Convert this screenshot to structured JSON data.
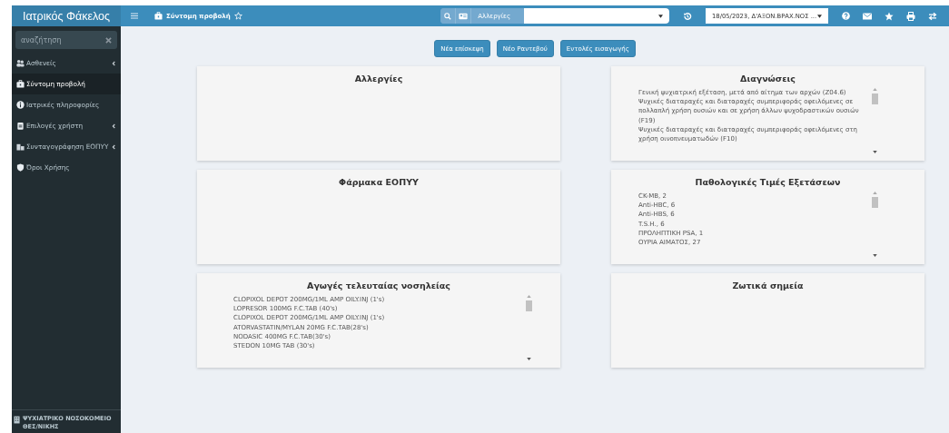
{
  "app_title": "Ιατρικός Φάκελος",
  "sidebar": {
    "search": {
      "placeholder": "αναζήτηση"
    },
    "items": [
      {
        "label": "Ασθενείς",
        "expandable": true,
        "selected": false
      },
      {
        "label": "Σύντομη προβολή",
        "expandable": false,
        "selected": true
      },
      {
        "label": "Ιατρικές πληροφορίες",
        "expandable": false,
        "selected": false
      },
      {
        "label": "Επιλογές χρήστη",
        "expandable": true,
        "selected": false
      },
      {
        "label": "Συνταγογράφηση ΕΟΠΥΥ",
        "expandable": true,
        "selected": false
      },
      {
        "label": "Όροι Χρήσης",
        "expandable": false,
        "selected": false
      }
    ],
    "footer": "ΨΥΧΙΑΤΡΙΚΟ ΝΟΣΟΚΟΜΕΙΟ ΘΕΣ/ΝΙΚΗΣ"
  },
  "topbar": {
    "breadcrumb": "Σύντομη προβολή",
    "search_label": "Αλλεργίες",
    "visit": "18/05/2023, Δ'ΑΞΟΝ.ΒΡΑΧ.ΝΟΣ ..."
  },
  "buttons": [
    "Νέα επίσκεψη",
    "Νέο Ραντεβού",
    "Εντολές εισαγωγής"
  ],
  "cards": [
    {
      "title": "Αλλεργίες"
    },
    {
      "title": "Διαγνώσεις",
      "items": [
        "Γενική ψυχιατρική εξέταση, μετά από αίτημα των αρχών (Z04.6)",
        "Ψυχικές διαταραχές και διαταραχές συμπεριφοράς οφειλόμενες σε πολλαπλή χρήση ουσιών και σε χρήση άλλων ψυχοδραστικών ουσιών (F19)",
        "Ψυχικές διαταραχές και διαταραχές συμπεριφοράς οφειλόμενες στη χρήση οινοπνευματωδών (F10)"
      ]
    },
    {
      "title": "Φάρμακα ΕΟΠΥΥ"
    },
    {
      "title": "Παθολογικές Τιμές Εξετάσεων",
      "items": [
        "CK-MB, 2",
        "Anti-HBC, 6",
        "Anti-HBS, 6",
        "T.S.H., 6",
        "ΠΡΟΛΗΠΤΙΚΗ PSA, 1",
        "ΟΥΡΙΑ ΑΙΜΑΤΟΣ, 27"
      ]
    },
    {
      "title": "Αγωγές τελευταίας νοσηλείας",
      "items": [
        "CLOPIXOL DEPOT 200MG/1ML AMP OILY.INJ (1's)",
        "LOPRESOR 100MG F.C.TAB (40's)",
        "CLOPIXOL DEPOT 200MG/1ML AMP OILY.INJ (1's)",
        "ATORVASTATIN/MYLAN 20MG F.C.TAB(28's)",
        "NODASIC 400MG F.C.TAB(30's)",
        "STEDON 10MG TAB (30's)"
      ]
    },
    {
      "title": "Ζωτικά σημεία"
    }
  ]
}
